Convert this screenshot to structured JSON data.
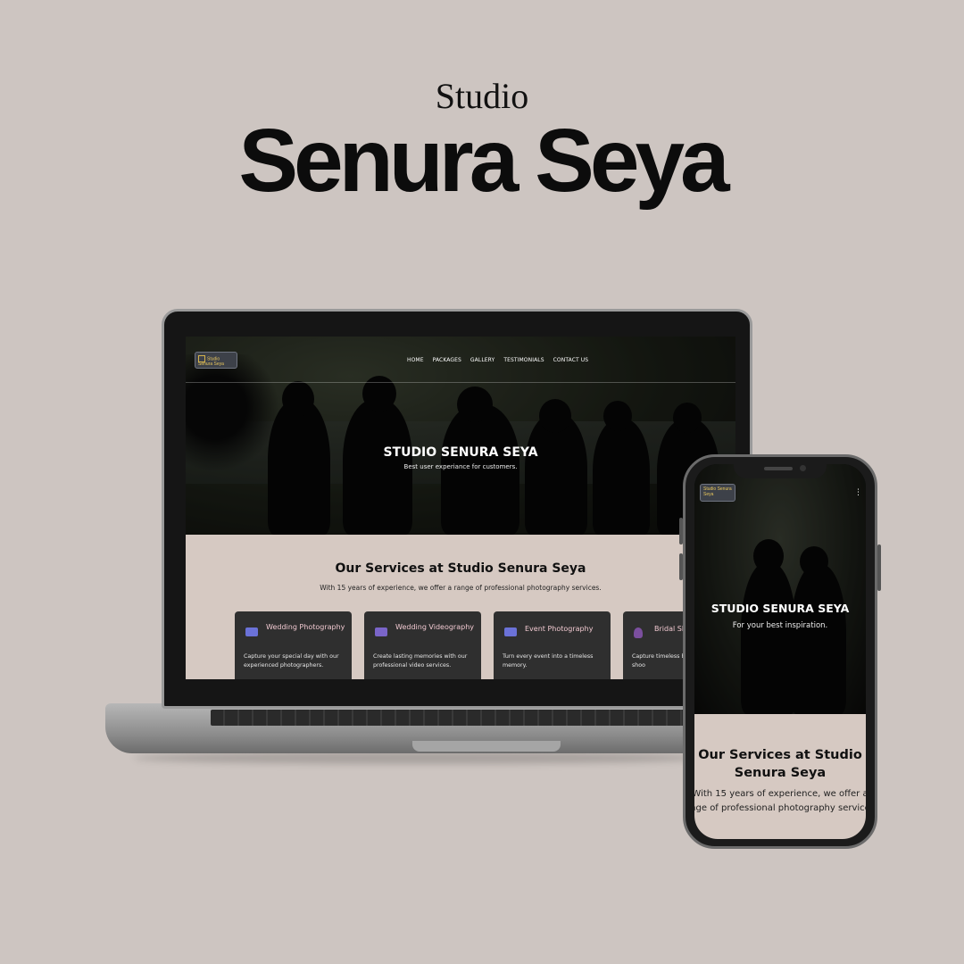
{
  "headline": {
    "small": "Studio",
    "big": "Senura Seya"
  },
  "site": {
    "logo_text": "Studio Senura Seya",
    "nav": [
      "HOME",
      "PACKAGES",
      "GALLERY",
      "TESTIMONIALS",
      "CONTACT US"
    ],
    "hero": {
      "title": "STUDIO SENURA SEYA",
      "subtitle": "Best user experiance for customers."
    },
    "services": {
      "title": "Our Services at Studio Senura Seya",
      "subtitle": "With 15 years of experience, we offer a range of professional photography services.",
      "cards": [
        {
          "icon": "camera-icon",
          "title": "Wedding Photography",
          "desc": "Capture your special day with our experienced photographers."
        },
        {
          "icon": "video-camera-icon",
          "title": "Wedding Videography",
          "desc": "Create lasting memories with our professional video services."
        },
        {
          "icon": "camera-icon",
          "title": "Event Photography",
          "desc": "Turn every event into a timeless memory."
        },
        {
          "icon": "bride-icon",
          "title": "Bridal Sh",
          "desc": "Capture timeless b classic bridal shoo"
        }
      ]
    }
  },
  "phone": {
    "logo_text": "Studio Senura Seya",
    "menu_icon": "more-vertical-icon",
    "hero": {
      "title": "STUDIO SENURA SEYA",
      "subtitle": "For your best inspiration."
    },
    "services": {
      "title_line1": "Our Services at Studio",
      "title_line2": "Senura Seya",
      "sub_line1": "With 15 years of experience, we offer a",
      "sub_line2": "nge of professional photography service"
    }
  },
  "colors": {
    "background": "#cdc5c1",
    "services_bg": "#d6c9c2",
    "card_bg": "#2f2f2f",
    "card_title": "#f0c8d0",
    "logo_gold": "#e9c75c"
  }
}
